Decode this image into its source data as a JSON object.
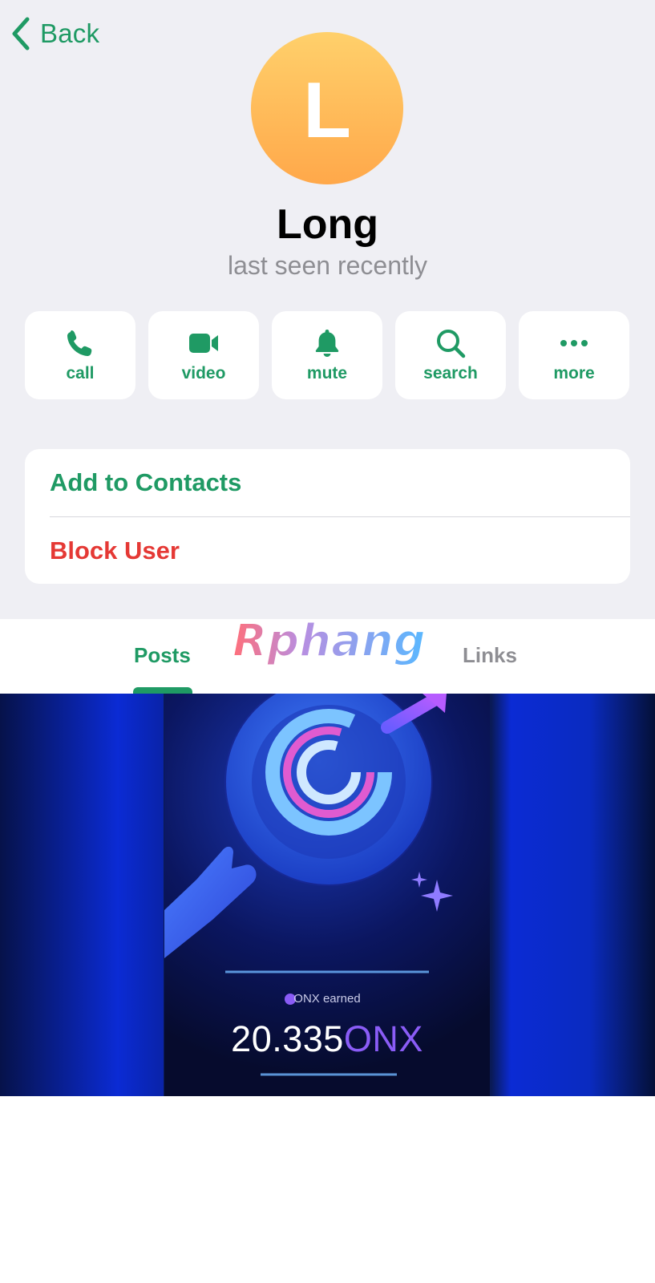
{
  "header": {
    "back_label": "Back"
  },
  "profile": {
    "avatar_letter": "L",
    "name": "Long",
    "status": "last seen recently"
  },
  "actions": [
    {
      "label": "call",
      "icon": "phone-icon"
    },
    {
      "label": "video",
      "icon": "video-camera-icon"
    },
    {
      "label": "mute",
      "icon": "bell-icon"
    },
    {
      "label": "search",
      "icon": "search-icon"
    },
    {
      "label": "more",
      "icon": "more-dots-icon"
    }
  ],
  "contact_options": {
    "add_label": "Add to Contacts",
    "block_label": "Block User"
  },
  "tabs": {
    "posts_label": "Posts",
    "links_label": "Links"
  },
  "watermark": {
    "text": "Rphang"
  },
  "post_media": {
    "earned_label": "ONX earned",
    "amount": "20.335",
    "unit": "ONX"
  },
  "colors": {
    "accent": "#1f9a64",
    "danger": "#e53935",
    "background": "#efeff4",
    "secondary_text": "#8e8e93"
  }
}
